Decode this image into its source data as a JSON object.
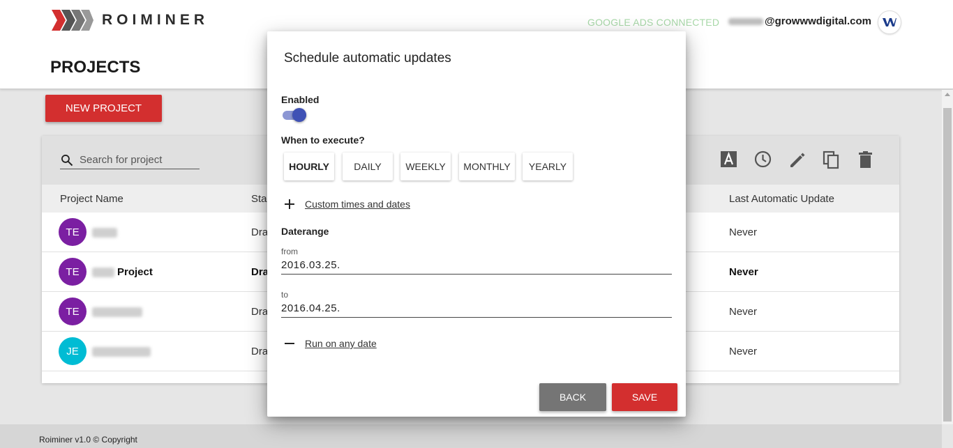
{
  "brand": {
    "name": "ROIMINER",
    "logo": "roiminer-logo"
  },
  "header": {
    "google_ads_status": "GOOGLE ADS CONNECTED",
    "user_email_domain": "@growwwdigital.com",
    "avatar": "company-avatar-icon"
  },
  "page": {
    "title": "PROJECTS",
    "new_project_label": "NEW PROJECT"
  },
  "toolbar": {
    "search_placeholder": "Search for project",
    "icons": [
      "text-format-icon",
      "clock-icon",
      "edit-icon",
      "copy-icon",
      "delete-icon"
    ]
  },
  "table": {
    "columns": [
      "Project Name",
      "Sta",
      "Last Automatic Update"
    ],
    "rows": [
      {
        "initials": "TE",
        "name": "",
        "status": "Dra",
        "last_update": "Never",
        "color": "#7b1fa2",
        "bold": false
      },
      {
        "initials": "TE",
        "name": "Project",
        "status": "Dra",
        "last_update": "Never",
        "color": "#7b1fa2",
        "bold": true
      },
      {
        "initials": "TE",
        "name": "",
        "status": "Dra",
        "last_update": "Never",
        "color": "#7b1fa2",
        "bold": false
      },
      {
        "initials": "JE",
        "name": "",
        "status": "Dra",
        "last_update": "Never",
        "color": "#00bcd4",
        "bold": false
      }
    ]
  },
  "footer": {
    "text": "Roiminer v1.0 © Copyright"
  },
  "dialog": {
    "title": "Schedule automatic updates",
    "enabled_label": "Enabled",
    "enabled": true,
    "when_label": "When to execute?",
    "frequencies": [
      "HOURLY",
      "DAILY",
      "WEEKLY",
      "MONTHLY",
      "YEARLY"
    ],
    "selected_frequency": "HOURLY",
    "custom_link": "Custom times and dates",
    "daterange_label": "Daterange",
    "from_label": "from",
    "from_value": "2016.03.25.",
    "to_label": "to",
    "to_value": "2016.04.25.",
    "run_any_link": "Run on any date",
    "back_label": "BACK",
    "save_label": "SAVE"
  },
  "colors": {
    "primary_red": "#d32f2f",
    "toggle_blue": "#3f51b5",
    "back_grey": "#757575",
    "connected_green": "#a8d8a8"
  }
}
